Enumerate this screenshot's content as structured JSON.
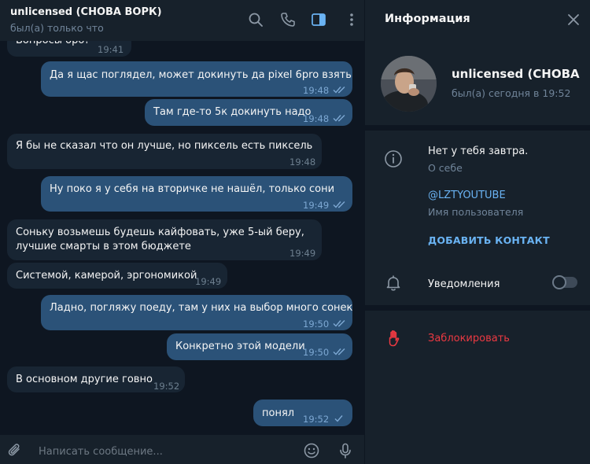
{
  "chat": {
    "title": "unlicensed (СНОВА ВОРК)",
    "status": "был(а) только что",
    "header_icons": [
      "search-icon",
      "phone-icon",
      "sidebar-toggle-icon",
      "more-vertical-icon"
    ],
    "messages": [
      {
        "dir": "in",
        "text": "Вопросы оро?",
        "time": "19:41"
      },
      {
        "dir": "out",
        "text": "Да я щас поглядел, может докинуть да pixel 6pro взять",
        "time": "19:48",
        "read": true
      },
      {
        "dir": "out",
        "text": "Там где-то 5к докинуть надо",
        "time": "19:48",
        "read": true
      },
      {
        "dir": "in",
        "text": "Я бы не сказал что он лучше, но пиксель есть пиксель",
        "time": "19:48"
      },
      {
        "dir": "out",
        "text": "Ну поко я у себя на вторичке не нашёл, только сони",
        "time": "19:49",
        "read": true
      },
      {
        "dir": "in",
        "line1": "Соньку возьмешь будешь кайфовать, уже 5-ый беру,",
        "line2": "лучшие смарты в этом бюджете",
        "time": "19:49"
      },
      {
        "dir": "in",
        "text": "Системой, камерой, эргономикой",
        "time": "19:49"
      },
      {
        "dir": "out",
        "text": "Ладно, погляжу поеду, там у них на выбор много сонек",
        "time": "19:50",
        "read": true
      },
      {
        "dir": "out",
        "text": "Конкретно этой модели",
        "time": "19:50",
        "read": true
      },
      {
        "dir": "in",
        "text": "В основном другие говно",
        "time": "19:52"
      },
      {
        "dir": "out",
        "text": "понял",
        "time": "19:52",
        "read": false
      }
    ],
    "composer": {
      "placeholder": "Написать сообщение...",
      "icons": [
        "attach-icon",
        "emoji-icon",
        "microphone-icon"
      ]
    }
  },
  "info": {
    "title": "Информация",
    "name": "unlicensed (СНОВА ВОРК)",
    "status": "был(а) сегодня в 19:52",
    "bio": "Нет у тебя завтра.",
    "bio_label": "О себе",
    "username": "@LZTYOUTUBE",
    "username_label": "Имя пользователя",
    "add_contact": "ДОБАВИТЬ КОНТАКТ",
    "notifications": "Уведомления",
    "notifications_on": false,
    "block": "Заблокировать"
  },
  "colors": {
    "chat_bg": "#0e1621",
    "panel_bg": "#17212b",
    "bubble_in": "#182533",
    "bubble_out": "#2b5278",
    "accent": "#6ab3f3",
    "danger": "#ec3942"
  }
}
